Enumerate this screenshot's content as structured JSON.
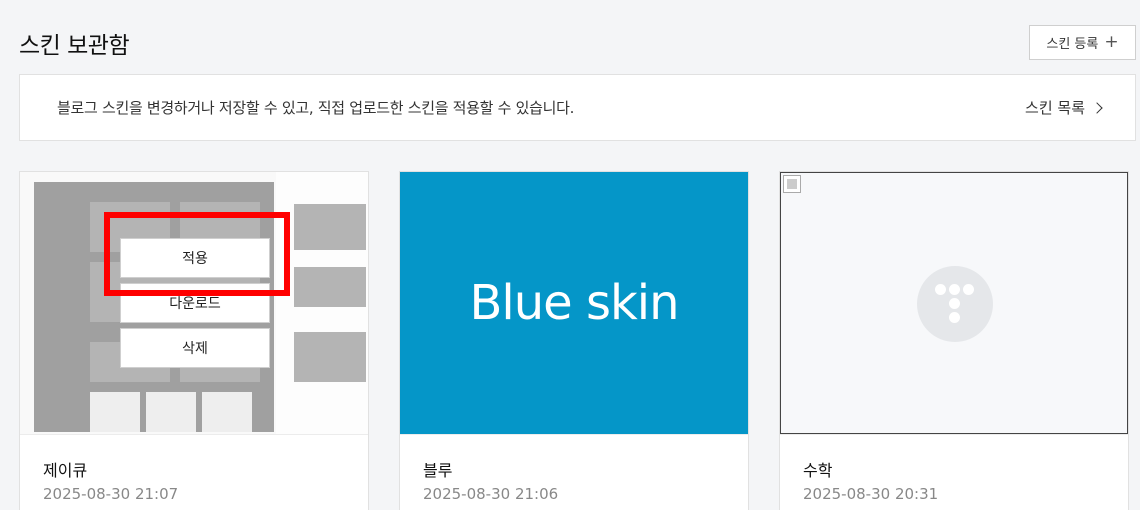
{
  "header": {
    "title": "스킨 보관함",
    "register_label": "스킨 등록",
    "register_icon": "plus-icon"
  },
  "info": {
    "text": "블로그 스킨을 변경하거나 저장할 수 있고, 직접 업로드한 스킨을 적용할 수 있습니다.",
    "list_link": "스킨 목록"
  },
  "cards": [
    {
      "name": "제이큐",
      "date": "2025-08-30 21:07",
      "actions": {
        "apply": "적용",
        "download": "다운로드",
        "delete": "삭제"
      }
    },
    {
      "name": "블루",
      "date": "2025-08-30 21:06",
      "thumb_text": "Blue skin",
      "thumb_color": "#0596c8"
    },
    {
      "name": "수학",
      "date": "2025-08-30 20:31",
      "thumb_icon": "tistory-logo-icon"
    }
  ],
  "colors": {
    "highlight": "#ff0000",
    "blue_skin": "#0596c8"
  }
}
